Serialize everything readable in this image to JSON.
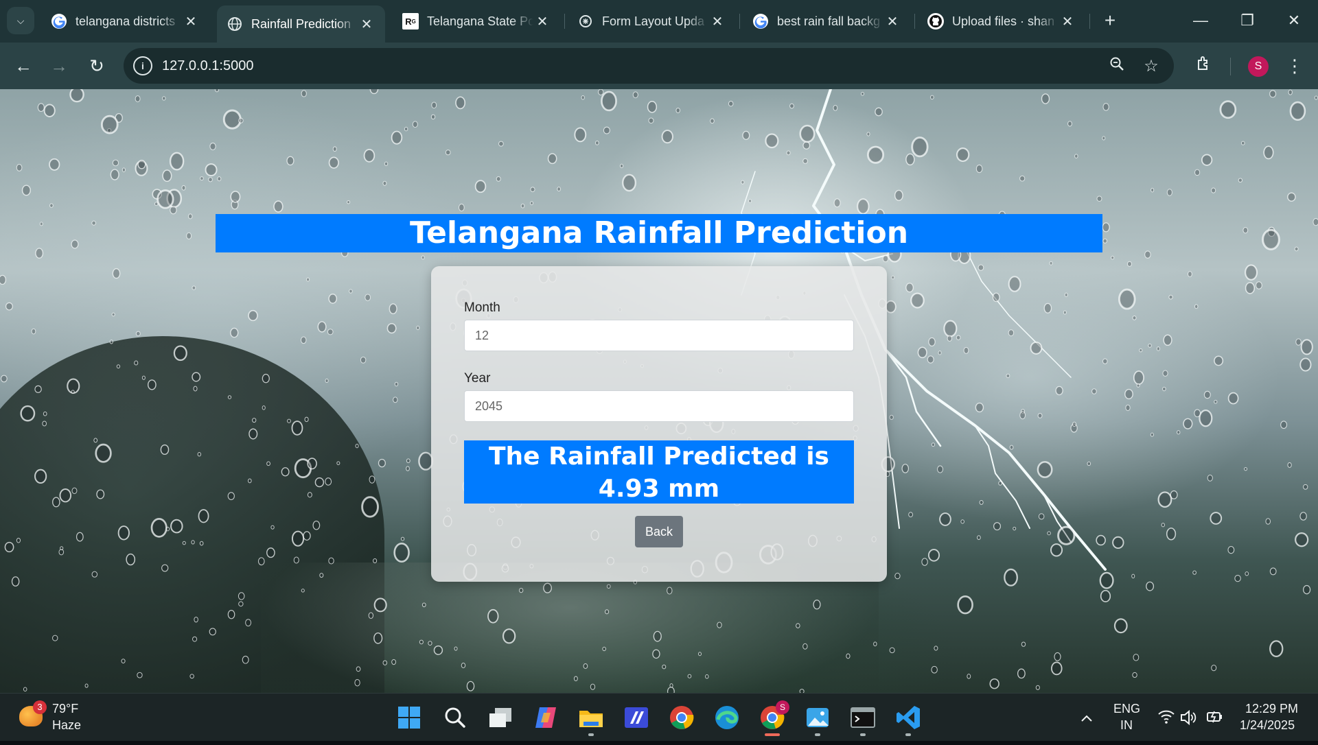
{
  "browser": {
    "tabs": [
      {
        "title": "telangana districts",
        "icon": "google-icon",
        "active": false
      },
      {
        "title": "Rainfall Prediction",
        "icon": "globe-icon",
        "active": true
      },
      {
        "title": "Telangana State Po",
        "icon": "researchgate-icon",
        "active": false
      },
      {
        "title": "Form Layout Upda",
        "icon": "chatgpt-icon",
        "active": false
      },
      {
        "title": "best rain fall backg",
        "icon": "google-icon",
        "active": false
      },
      {
        "title": "Upload files · shan",
        "icon": "github-icon",
        "active": false
      }
    ],
    "url": "127.0.0.1:5000",
    "profile_initial": "S"
  },
  "page": {
    "title": "Telangana Rainfall Prediction",
    "form": {
      "month_label": "Month",
      "month_value": "12",
      "year_label": "Year",
      "year_value": "2045"
    },
    "result_text": "The Rainfall Predicted is 4.93 mm",
    "back_label": "Back",
    "accent_color": "#007bff"
  },
  "taskbar": {
    "weather": {
      "badge": "3",
      "temp": "79°F",
      "condition": "Haze"
    },
    "apps": [
      "start-icon",
      "search-icon",
      "task-view-icon",
      "copilot-icon",
      "file-explorer-icon",
      "visual-studio-icon",
      "chrome-icon",
      "edge-icon",
      "chrome-profile-icon",
      "photos-icon",
      "terminal-icon",
      "vscode-icon"
    ],
    "chrome_profile_badge": "S",
    "language": {
      "line1": "ENG",
      "line2": "IN"
    },
    "clock": {
      "time": "12:29 PM",
      "date": "1/24/2025"
    }
  }
}
